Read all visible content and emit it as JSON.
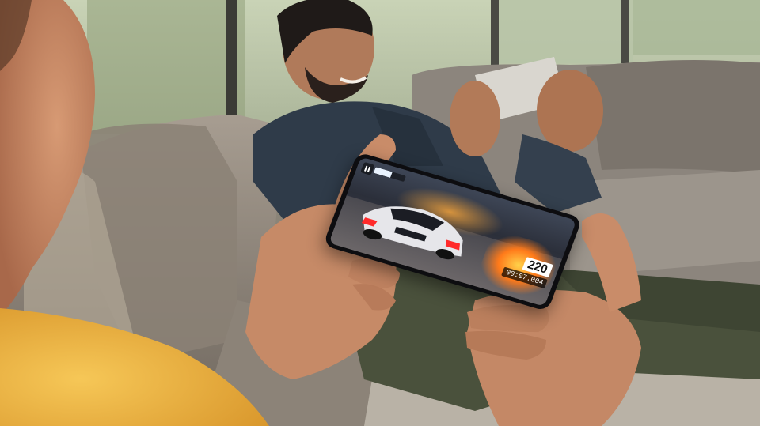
{
  "game": {
    "speed": "220",
    "timer": "00:07.004",
    "nitro_level": 0.55,
    "pause_icon": "pause-icon"
  },
  "colors": {
    "sweater": "#f0b84a",
    "sofa": "#8e857a",
    "shirt": "#2f3b49",
    "pants": "#4a513c",
    "skin": "#c68a67",
    "window_light": "#d9e4d2"
  }
}
